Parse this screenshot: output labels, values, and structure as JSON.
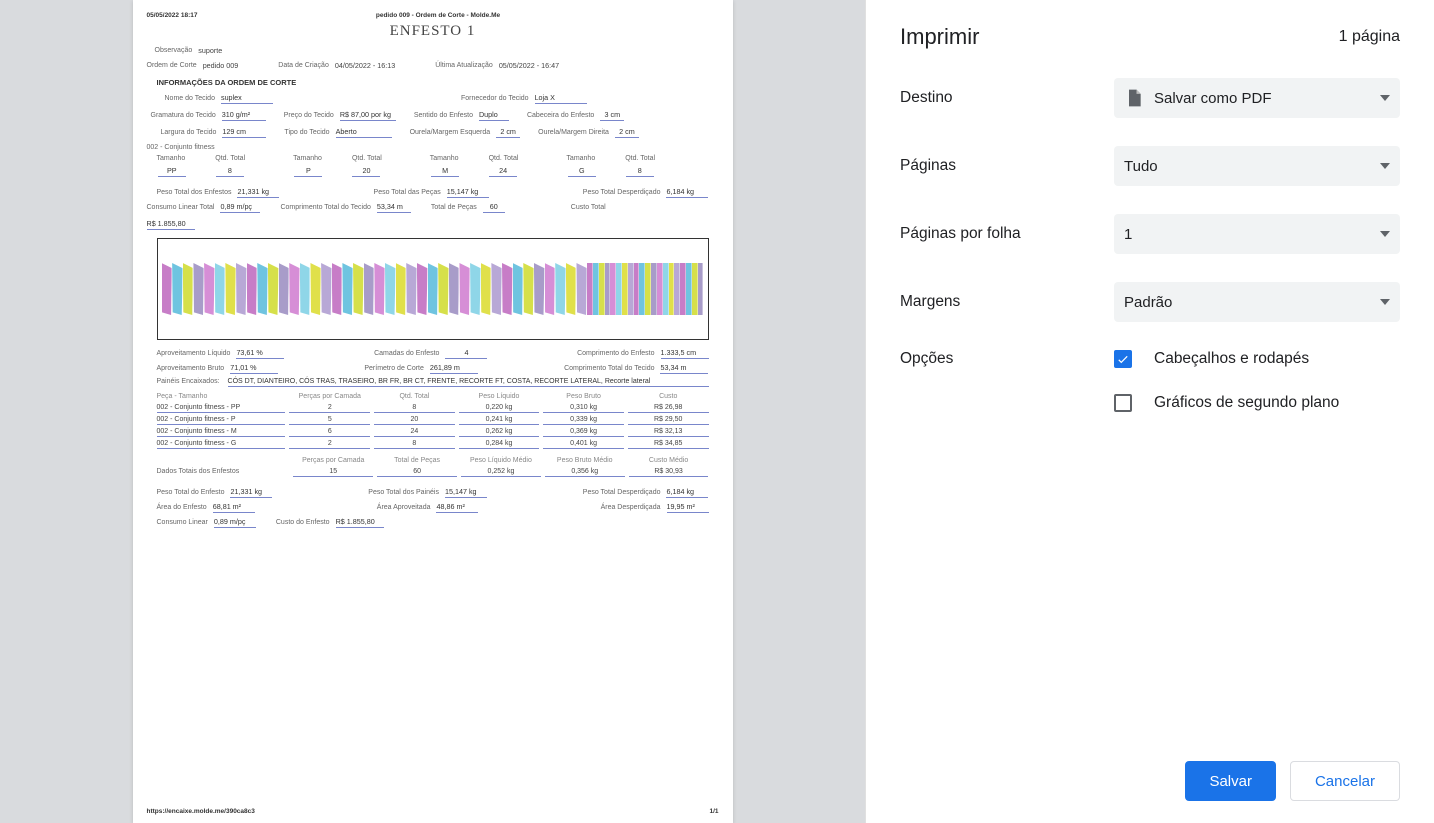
{
  "panel": {
    "title": "Imprimir",
    "count": "1 página",
    "destino_label": "Destino",
    "destino_value": "Salvar como PDF",
    "paginas_label": "Páginas",
    "paginas_value": "Tudo",
    "ppf_label": "Páginas por folha",
    "ppf_value": "1",
    "margens_label": "Margens",
    "margens_value": "Padrão",
    "opcoes_label": "Opções",
    "cb1_label": "Cabeçalhos e rodapés",
    "cb2_label": "Gráficos de segundo plano",
    "save": "Salvar",
    "cancel": "Cancelar"
  },
  "page": {
    "ts": "05/05/2022 18:17",
    "doc_title": "pedido 009 - Ordem de Corte - Molde.Me",
    "title": "ENFESTO 1",
    "obs_l": "Observação",
    "obs_v": "suporte",
    "oc_l": "Ordem de Corte",
    "oc_v": "pedido 009",
    "dc_l": "Data de Criação",
    "dc_v": "04/05/2022 - 16:13",
    "ua_l": "Última Atualização",
    "ua_v": "05/05/2022 - 16:47",
    "info_title": "INFORMAÇÕES DA ORDEM DE CORTE",
    "nome_l": "Nome do Tecido",
    "nome_v": "suplex",
    "forn_l": "Fornecedor do Tecido",
    "forn_v": "Loja X",
    "gram_l": "Gramatura do Tecido",
    "gram_v": "310 g/m²",
    "preco_l": "Preço do Tecido",
    "preco_v": "R$ 87,00 por kg",
    "sent_l": "Sentido do Enfesto",
    "sent_v": "Duplo",
    "cab_l": "Cabeceira do Enfesto",
    "cab_v": "3 cm",
    "larg_l": "Largura do Tecido",
    "larg_v": "129 cm",
    "tipo_l": "Tipo do Tecido",
    "tipo_v": "Aberto",
    "ome_l": "Ourela/Margem Esquerda",
    "ome_v": "2 cm",
    "omd_l": "Ourela/Margem Direita",
    "omd_v": "2 cm",
    "produto": "002 - Conjunto fitness",
    "th_tam": "Tamanho",
    "th_qtd": "Qtd. Total",
    "sizes": [
      {
        "t": "PP",
        "q": "8"
      },
      {
        "t": "P",
        "q": "20"
      },
      {
        "t": "M",
        "q": "24"
      },
      {
        "t": "G",
        "q": "8"
      }
    ],
    "pte_l": "Peso Total dos Enfestos",
    "pte_v": "21,331 kg",
    "ptp_l": "Peso Total das Peças",
    "ptp_v": "15,147 kg",
    "ptd_l": "Peso Total Desperdiçado",
    "ptd_v": "6,184 kg",
    "clt_l": "Consumo Linear Total",
    "clt_v": "0,89 m/pç",
    "ctt_l": "Comprimento Total do Tecido",
    "ctt_v": "53,34 m",
    "tdp_l": "Total de Peças",
    "tdp_v": "60",
    "ct_l": "Custo Total",
    "ct_v": "R$ 1.855,80",
    "aliq_l": "Aproveitamento Líquido",
    "aliq_v": "73,61 %",
    "cam_l": "Camadas do Enfesto",
    "cam_v": "4",
    "ce_l": "Comprimento do Enfesto",
    "ce_v": "1.333,5 cm",
    "abru_l": "Aproveitamento Bruto",
    "abru_v": "71,01 %",
    "per_l": "Perímetro de Corte",
    "per_v": "261,89 m",
    "ctt2_l": "Comprimento Total do Tecido",
    "ctt2_v": "53,34 m",
    "pan_l": "Painéis Encaixados:",
    "pan_v": "CÓS DT, DIANTEIRO, CÓS TRAS, TRASEIRO, BR FR, BR CT, FRENTE, RECORTE FT, COSTA, RECORTE LATERAL, Recorte lateral",
    "th": [
      "Peça - Tamanho",
      "Perças por Camada",
      "Qtd. Total",
      "Peso Líquido",
      "Peso Bruto",
      "Custo"
    ],
    "rows": [
      [
        "002 - Conjunto fitness - PP",
        "2",
        "8",
        "0,220 kg",
        "0,310 kg",
        "R$ 26,98"
      ],
      [
        "002 - Conjunto fitness - P",
        "5",
        "20",
        "0,241 kg",
        "0,339 kg",
        "R$ 29,50"
      ],
      [
        "002 - Conjunto fitness - M",
        "6",
        "24",
        "0,262 kg",
        "0,369 kg",
        "R$ 32,13"
      ],
      [
        "002 - Conjunto fitness - G",
        "2",
        "8",
        "0,284 kg",
        "0,401 kg",
        "R$ 34,85"
      ]
    ],
    "tot_l": "Dados Totais dos Enfestos",
    "tot_h": [
      "Perças por Camada",
      "Total de Peças",
      "Peso Líquido Médio",
      "Peso Bruto Médio",
      "Custo Médio"
    ],
    "tot_r": [
      "15",
      "60",
      "0,252 kg",
      "0,356 kg",
      "R$ 30,93"
    ],
    "pte2_l": "Peso Total do Enfesto",
    "pte2_v": "21,331 kg",
    "ptp2_l": "Peso Total dos Painéis",
    "ptp2_v": "15,147 kg",
    "ptd2_l": "Peso Total Desperdiçado",
    "ptd2_v": "6,184 kg",
    "ae_l": "Área do Enfesto",
    "ae_v": "68,81 m²",
    "aa_l": "Área Aproveitada",
    "aa_v": "48,86 m²",
    "ad_l": "Área Desperdiçada",
    "ad_v": "19,95 m²",
    "cl_l": "Consumo Linear",
    "cl_v": "0,89 m/pç",
    "custoe_l": "Custo do Enfesto",
    "custoe_v": "R$ 1.855,80",
    "footer_url": "https://encaixe.molde.me/390ca8c3",
    "footer_page": "1/1"
  }
}
